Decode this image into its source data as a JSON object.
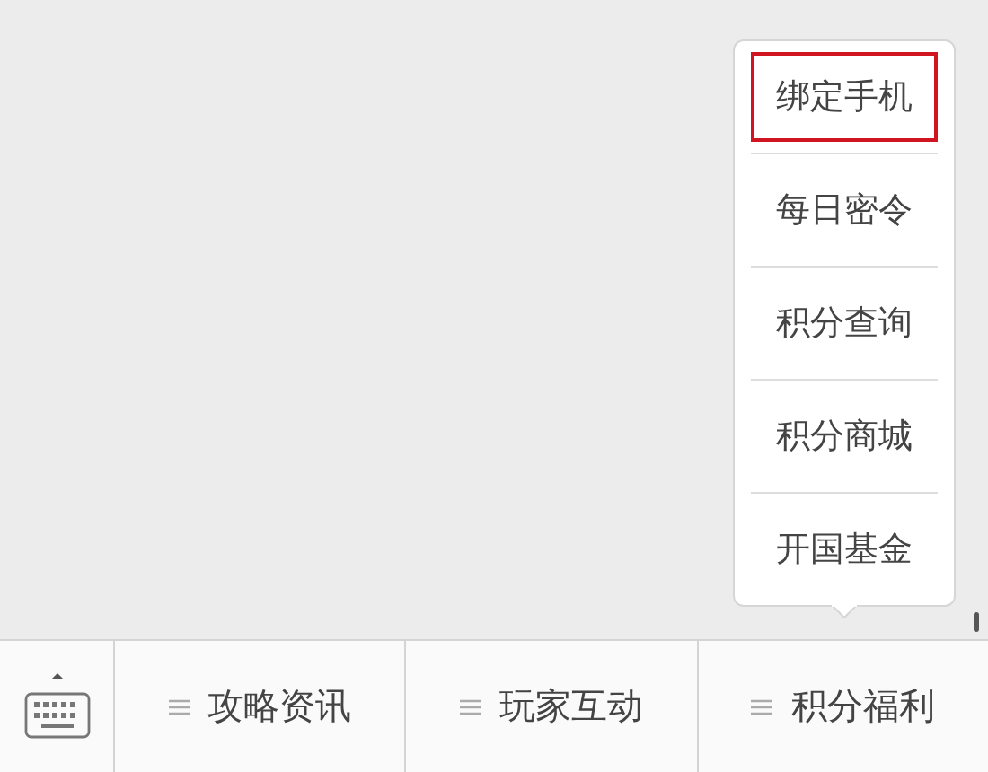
{
  "menus": [
    {
      "label": "攻略资讯"
    },
    {
      "label": "玩家互动"
    },
    {
      "label": "积分福利",
      "submenu": [
        {
          "label": "绑定手机",
          "highlighted": true
        },
        {
          "label": "每日密令",
          "highlighted": false
        },
        {
          "label": "积分查询",
          "highlighted": false
        },
        {
          "label": "积分商城",
          "highlighted": false
        },
        {
          "label": "开国基金",
          "highlighted": false
        }
      ]
    }
  ]
}
